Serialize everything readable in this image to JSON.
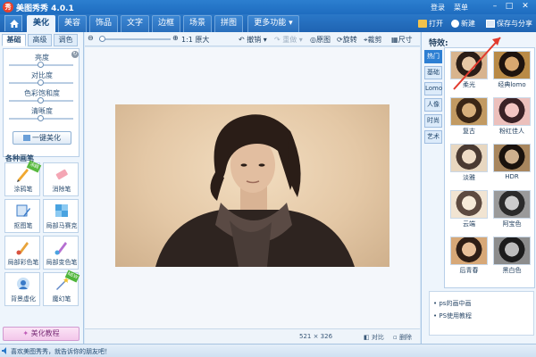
{
  "titlebar": {
    "logo": "秀",
    "app_title": "美图秀秀 4.0.1",
    "login_label": "登录",
    "menu_label": "菜单",
    "minimize_icon": "minimize-icon",
    "maximize_icon": "maximize-icon",
    "close_icon": "close-icon"
  },
  "tabs": {
    "items": [
      "美化",
      "美容",
      "饰品",
      "文字",
      "边框",
      "场景",
      "拼图",
      "更多功能 ▾"
    ],
    "active_index": 0,
    "open_label": "打开",
    "new_label": "新建",
    "save_share_label": "保存与分享"
  },
  "left": {
    "subtabs": [
      "基础",
      "高级",
      "调色"
    ],
    "sliders": [
      {
        "label": "亮度",
        "value": 0.5
      },
      {
        "label": "对比度",
        "value": 0.5
      },
      {
        "label": "色彩饱和度",
        "value": 0.5
      },
      {
        "label": "清晰度",
        "value": 0.5
      }
    ],
    "one_key_label": "一键美化",
    "brush_title": "各种画笔",
    "brushes": [
      {
        "label": "涂鸦笔",
        "icon": "doodle-pen-icon",
        "badge": "涂鸦"
      },
      {
        "label": "消除笔",
        "icon": "eraser-icon",
        "badge": ""
      },
      {
        "label": "抠图笔",
        "icon": "cutout-pen-icon",
        "badge": ""
      },
      {
        "label": "局部马赛克",
        "icon": "mosaic-icon",
        "badge": ""
      },
      {
        "label": "局部彩色笔",
        "icon": "color-brush-icon",
        "badge": ""
      },
      {
        "label": "局部变色笔",
        "icon": "color-change-icon",
        "badge": ""
      },
      {
        "label": "背景虚化",
        "icon": "background-blur-icon",
        "badge": ""
      },
      {
        "label": "魔幻笔",
        "icon": "magic-wand-icon",
        "badge": "NEW"
      }
    ],
    "tutorial_label": "美化教程"
  },
  "toolbar": {
    "zoom_level": 0.0,
    "actual_size_label": "1:1 原大",
    "undo_label": "撤销",
    "redo_label": "重做",
    "restore_label": "原图",
    "rotate_label": "旋转",
    "crop_label": "裁剪",
    "size_label": "尺寸"
  },
  "image_status": {
    "dimensions": "521 × 326",
    "compare_label": "对比",
    "delete_label": "删除"
  },
  "right": {
    "title": "特效:",
    "categories": [
      "热门",
      "基础",
      "Lomo",
      "人像",
      "时尚",
      "艺术"
    ],
    "active_category": 0,
    "effects": [
      "柔光",
      "经典lomo",
      "复古",
      "粉红佳人",
      "淡雅",
      "HDR",
      "云端",
      "阿宝色",
      "后青春",
      "黑白色"
    ],
    "news": [
      "ps的画中画",
      "PS使用教程"
    ]
  },
  "bottom": {
    "message": "喜欢美图秀秀，就告诉你的朋友吧！"
  },
  "colors": {
    "accent": "#2a78c8",
    "annotation_arrow": "#e23a2e"
  }
}
